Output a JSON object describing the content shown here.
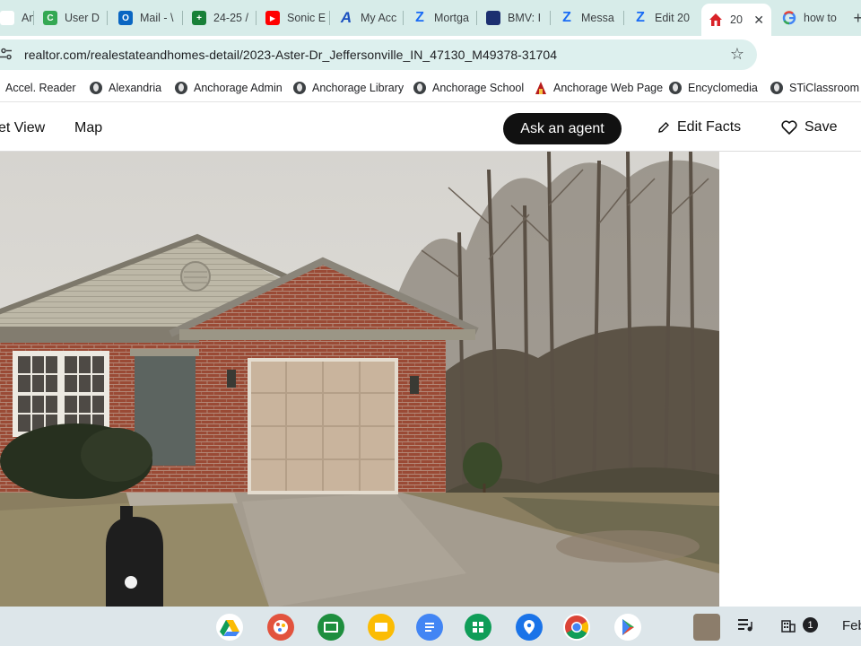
{
  "browser": {
    "tabs": [
      {
        "title": "Ancho",
        "icon": "anchorage-icon",
        "color": "#d93025"
      },
      {
        "title": "User D",
        "icon": "c-app-icon",
        "color": "#34a853"
      },
      {
        "title": "Mail - \\",
        "icon": "outlook-icon",
        "color": "#0a66c2"
      },
      {
        "title": "24-25 /",
        "icon": "sheets-icon",
        "color": "#188038"
      },
      {
        "title": "Sonic E",
        "icon": "youtube-icon",
        "color": "#ff0000"
      },
      {
        "title": "My Acc",
        "icon": "a-logo-icon",
        "color": "#1a4fbf"
      },
      {
        "title": "Mortga",
        "icon": "zillow-icon",
        "color": "#1a6cf5"
      },
      {
        "title": "BMV: I",
        "icon": "bmv-icon",
        "color": "#1c2f70"
      },
      {
        "title": "Messa",
        "icon": "zillow-icon",
        "color": "#1a6cf5"
      },
      {
        "title": "Edit 20",
        "icon": "zillow-icon",
        "color": "#1a6cf5"
      },
      {
        "title": "20",
        "icon": "realtor-home-icon",
        "color": "#d92228",
        "active": true
      },
      {
        "title": "how to",
        "icon": "google-icon",
        "color": "#4285f4"
      }
    ],
    "url": "realtor.com/realestateandhomes-detail/2023-Aster-Dr_Jeffersonville_IN_47130_M49378-31704",
    "bookmarks": [
      {
        "label": "Accel. Reader"
      },
      {
        "label": "Alexandria"
      },
      {
        "label": "Anchorage Admin"
      },
      {
        "label": "Anchorage Library"
      },
      {
        "label": "Anchorage School"
      },
      {
        "label": "Anchorage Web Page"
      },
      {
        "label": "Encyclomedia"
      },
      {
        "label": "STiClassroom"
      }
    ]
  },
  "page": {
    "nav": {
      "street_view": "et View",
      "map": "Map"
    },
    "ask_agent": "Ask an agent",
    "edit_facts": "Edit Facts",
    "save": "Save"
  },
  "shelf": {
    "apps": [
      "drive-icon",
      "canvas-icon",
      "classroom-icon",
      "slides-icon",
      "docs-icon",
      "sheets-icon",
      "maps-icon",
      "chrome-icon",
      "play-store-icon"
    ],
    "notification_count": "1",
    "date": "Feb"
  }
}
